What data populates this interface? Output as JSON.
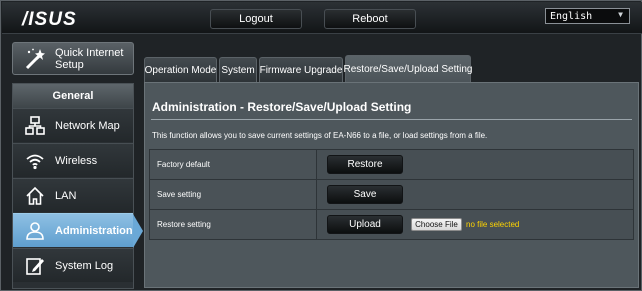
{
  "header": {
    "logo_text": "/ISUS",
    "logout_label": "Logout",
    "reboot_label": "Reboot",
    "language_value": "English"
  },
  "sidebar": {
    "quick_setup_line1": "Quick Internet",
    "quick_setup_line2": "Setup",
    "section_label": "General",
    "items": [
      {
        "label": "Network Map",
        "icon": "network-map-icon"
      },
      {
        "label": "Wireless",
        "icon": "wireless-icon"
      },
      {
        "label": "LAN",
        "icon": "home-icon"
      },
      {
        "label": "Administration",
        "icon": "administration-icon",
        "active": true
      },
      {
        "label": "System Log",
        "icon": "system-log-icon"
      }
    ]
  },
  "tabs": [
    {
      "label": "Operation Mode"
    },
    {
      "label": "System"
    },
    {
      "label": "Firmware Upgrade"
    },
    {
      "label": "Restore/Save/Upload Setting",
      "active": true
    }
  ],
  "main": {
    "title": "Administration - Restore/Save/Upload Setting",
    "description": "This function allows you to save current settings of EA-N66 to a file, or load settings from a file.",
    "rows": [
      {
        "label": "Factory default",
        "button": "Restore"
      },
      {
        "label": "Save setting",
        "button": "Save"
      },
      {
        "label": "Restore setting",
        "button": "Upload",
        "file_button": "Choose File",
        "file_status": "no file selected"
      }
    ]
  },
  "colors": {
    "active_nav": "#6aa8d6",
    "file_status": "#ffd400",
    "content_bg": "#4e575c"
  }
}
